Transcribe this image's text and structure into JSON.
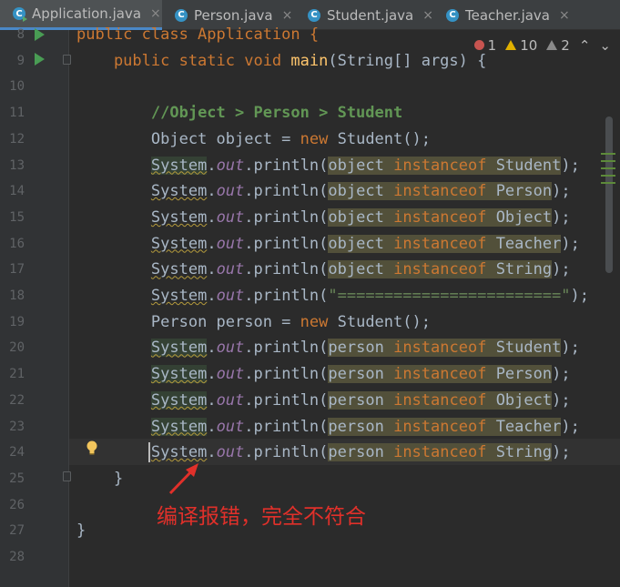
{
  "tabs": [
    {
      "label": "Application.java",
      "active": true,
      "icon": "java-class-run-icon"
    },
    {
      "label": "Person.java",
      "active": false,
      "icon": "java-class-icon"
    },
    {
      "label": "Student.java",
      "active": false,
      "icon": "java-class-icon"
    },
    {
      "label": "Teacher.java",
      "active": false,
      "icon": "java-class-icon"
    }
  ],
  "close_glyph": "×",
  "inspections": {
    "errors": "1",
    "warnings": "10",
    "weak_warnings": "2",
    "up": "⌃",
    "down": "⌄"
  },
  "lines": [
    {
      "n": "8",
      "t1": "public class Application {"
    },
    {
      "n": "9",
      "t1": "    public static void ",
      "t2": "main",
      "t3": "(String[] args) {"
    },
    {
      "n": "10"
    },
    {
      "n": "11",
      "comment": "//Object > Person > Student"
    },
    {
      "n": "12",
      "a": "Object object = ",
      "b": "new",
      "c": " Student();"
    },
    {
      "n": "13",
      "sys": "System",
      "out": "out",
      "pl": ".println(",
      "var": "object",
      "inst": "instanceof",
      "cls": "Student",
      "end": ");"
    },
    {
      "n": "14",
      "sys": "System",
      "out": "out",
      "pl": ".println(",
      "var": "object",
      "inst": "instanceof",
      "cls": "Person",
      "end": ");"
    },
    {
      "n": "15",
      "sys": "System",
      "out": "out",
      "pl": ".println(",
      "var": "object",
      "inst": "instanceof",
      "cls": "Object",
      "end": ");"
    },
    {
      "n": "16",
      "sys": "System",
      "out": "out",
      "pl": ".println(",
      "var": "object",
      "inst": "instanceof",
      "cls": "Teacher",
      "end": ");"
    },
    {
      "n": "17",
      "sys": "System",
      "out": "out",
      "pl": ".println(",
      "var": "object",
      "inst": "instanceof",
      "cls": "String",
      "end": ");"
    },
    {
      "n": "18",
      "sys": "System",
      "out": "out",
      "pl": ".println(",
      "str": "\"========================\"",
      "end": ");"
    },
    {
      "n": "19",
      "a": "Person person = ",
      "b": "new",
      "c": " Student();"
    },
    {
      "n": "20",
      "sys": "System",
      "out": "out",
      "pl": ".println(",
      "var": "person",
      "inst": "instanceof",
      "cls": "Student",
      "end": ");"
    },
    {
      "n": "21",
      "sys": "System",
      "out": "out",
      "pl": ".println(",
      "var": "person",
      "inst": "instanceof",
      "cls": "Person",
      "end": ");"
    },
    {
      "n": "22",
      "sys": "System",
      "out": "out",
      "pl": ".println(",
      "var": "person",
      "inst": "instanceof",
      "cls": "Object",
      "end": ");"
    },
    {
      "n": "23",
      "sys": "System",
      "out": "out",
      "pl": ".println(",
      "var": "person",
      "inst": "instanceof",
      "cls": "Teacher",
      "end": ");"
    },
    {
      "n": "24",
      "sys": "System",
      "out": "out",
      "pl": ".println(",
      "var": "person",
      "inst": "instanceof",
      "cls": "String",
      "end": ");"
    },
    {
      "n": "25",
      "t1": "    }"
    },
    {
      "n": "26"
    },
    {
      "n": "27",
      "t1": "}"
    },
    {
      "n": "28"
    }
  ],
  "annotation": "编译报错，完全不符合",
  "colors": {
    "error": "#c75450",
    "warning": "#e0b000",
    "accent": "#4a88c7",
    "annotation": "#e0302a"
  }
}
